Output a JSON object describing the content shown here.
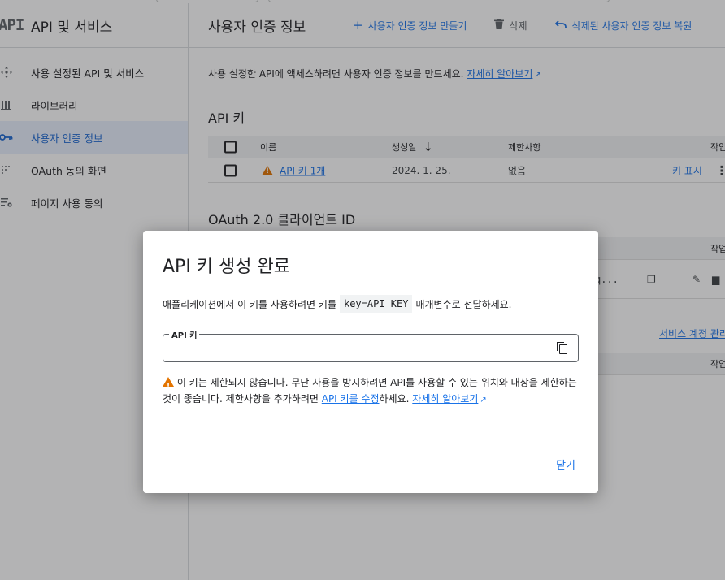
{
  "sidebar": {
    "logo": "API",
    "title": "API 및 서비스",
    "items": [
      {
        "label": "사용 설정된 API 및 서비스",
        "icon": "diamond-arrows-icon",
        "active": false
      },
      {
        "label": "라이브러리",
        "icon": "library-icon",
        "active": false
      },
      {
        "label": "사용자 인증 정보",
        "icon": "key-icon",
        "active": true
      },
      {
        "label": "OAuth 동의 화면",
        "icon": "consent-grid-icon",
        "active": false
      },
      {
        "label": "페이지 사용 동의",
        "icon": "settings-list-icon",
        "active": false
      }
    ]
  },
  "toolbar": {
    "title": "사용자 인증 정보",
    "create_label": "사용자 인증 정보 만들기",
    "delete_label": "삭제",
    "restore_label": "삭제된 사용자 인증 정보 복원"
  },
  "intro": {
    "text": "사용 설정한 API에 액세스하려면 사용자 인증 정보를 만드세요.",
    "link": "자세히 알아보기"
  },
  "api_keys": {
    "heading": "API 키",
    "columns": {
      "name": "이름",
      "created": "생성일",
      "restrictions": "제한사항",
      "actions": "작업"
    },
    "rows": [
      {
        "name": "API 키 1개",
        "created": "2024. 1. 25.",
        "restrictions": "없음",
        "action": "키 표시"
      }
    ]
  },
  "oauth": {
    "heading": "OAuth 2.0 클라이언트 ID",
    "actions_col": "작업",
    "masked_value": "q...",
    "service_link": "서비스 계정 관리",
    "actions_col2": "작업"
  },
  "dialog": {
    "title": "API 키 생성 완료",
    "text_before": "애플리케이션에서 이 키를 사용하려면 키를",
    "code": "key=API_KEY",
    "text_after": "매개변수로 전달하세요.",
    "field_label": "API 키",
    "field_value": "",
    "warning_text": "이 키는 제한되지 않습니다. 무단 사용을 방지하려면 API를 사용할 수 있는 위치와 대상을 제한하는 것이 좋습니다. 제한사항을 추가하려면",
    "warning_link1": "API 키를 수정",
    "warning_mid": "하세요.",
    "warning_link2": "자세히 알아보기",
    "close_label": "닫기"
  },
  "colors": {
    "accent": "#1a73e8",
    "warning": "#e37400",
    "active_bg": "#e8f0fe"
  }
}
